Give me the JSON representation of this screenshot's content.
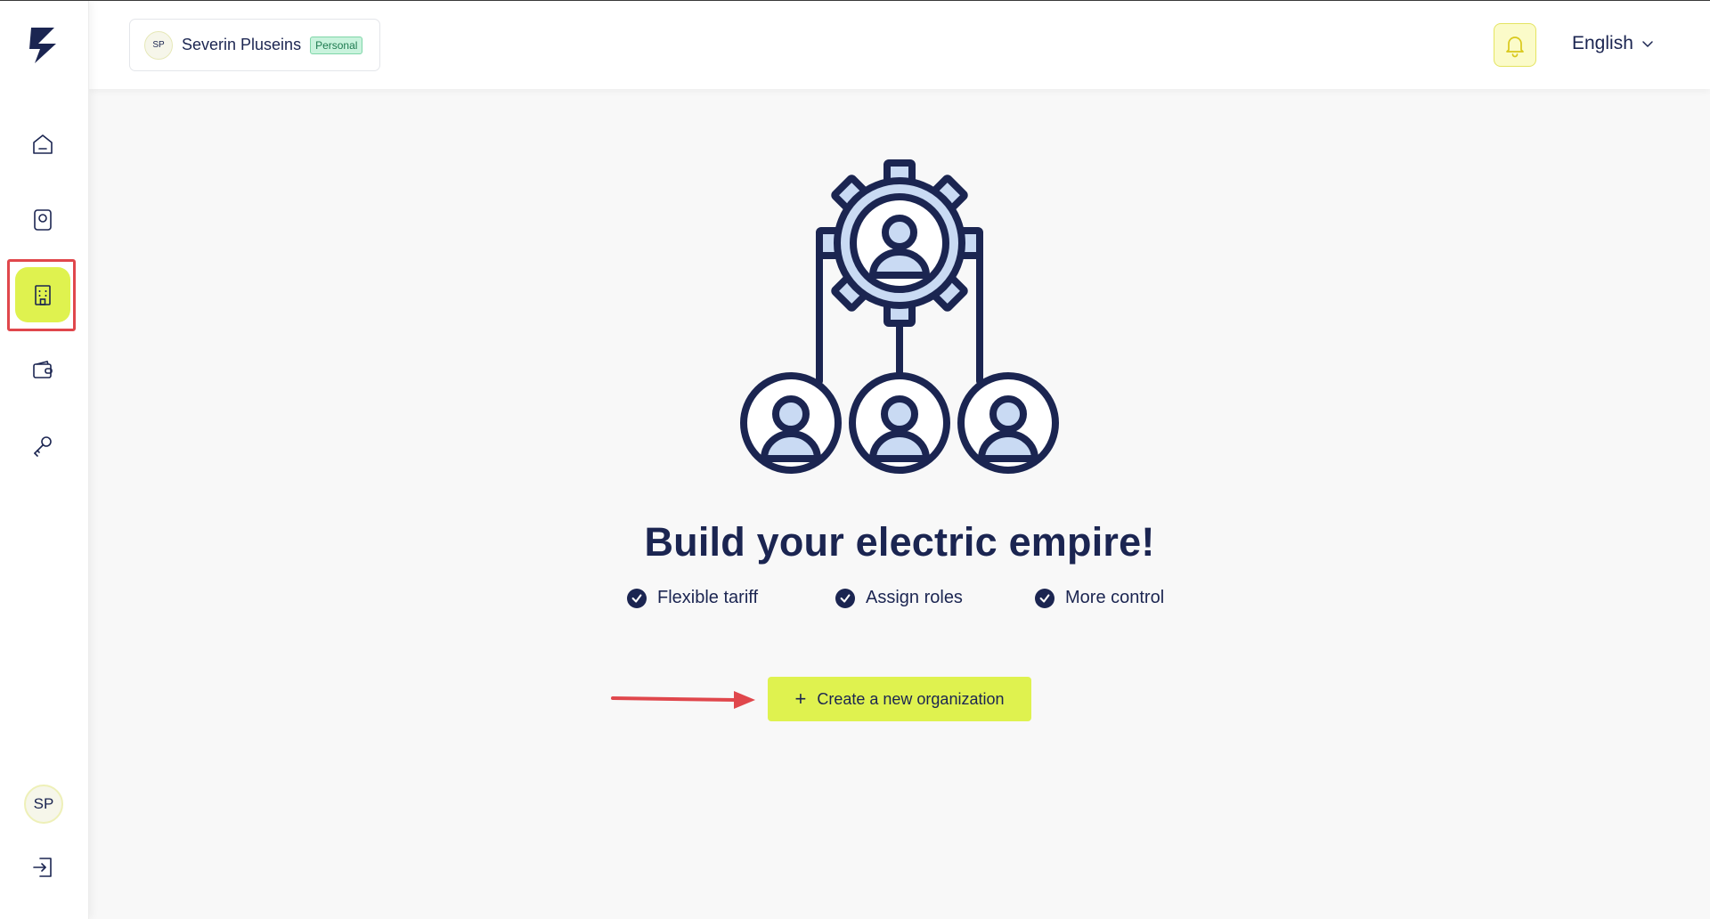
{
  "header": {
    "account": {
      "initials": "SP",
      "name": "Severin Pluseins",
      "badge": "Personal"
    },
    "language": {
      "selected": "English"
    }
  },
  "sidebar": {
    "items": [
      {
        "icon": "home-icon"
      },
      {
        "icon": "charger-icon"
      },
      {
        "icon": "building-icon",
        "active": true
      },
      {
        "icon": "wallet-icon"
      },
      {
        "icon": "key-icon"
      }
    ],
    "user_initials": "SP",
    "logout_icon": "logout-icon"
  },
  "main": {
    "illustration_icon": "organization-gear-icon",
    "title": "Build your electric empire!",
    "features": [
      {
        "label": "Flexible tariff"
      },
      {
        "label": "Assign roles"
      },
      {
        "label": "More control"
      }
    ],
    "create_button": {
      "icon": "plus",
      "label": "Create a new organization"
    }
  },
  "colors": {
    "accent": "#dff24f",
    "navy": "#1b2551",
    "illustration_fill": "#c9daf3",
    "highlight_red": "#e0474c"
  }
}
